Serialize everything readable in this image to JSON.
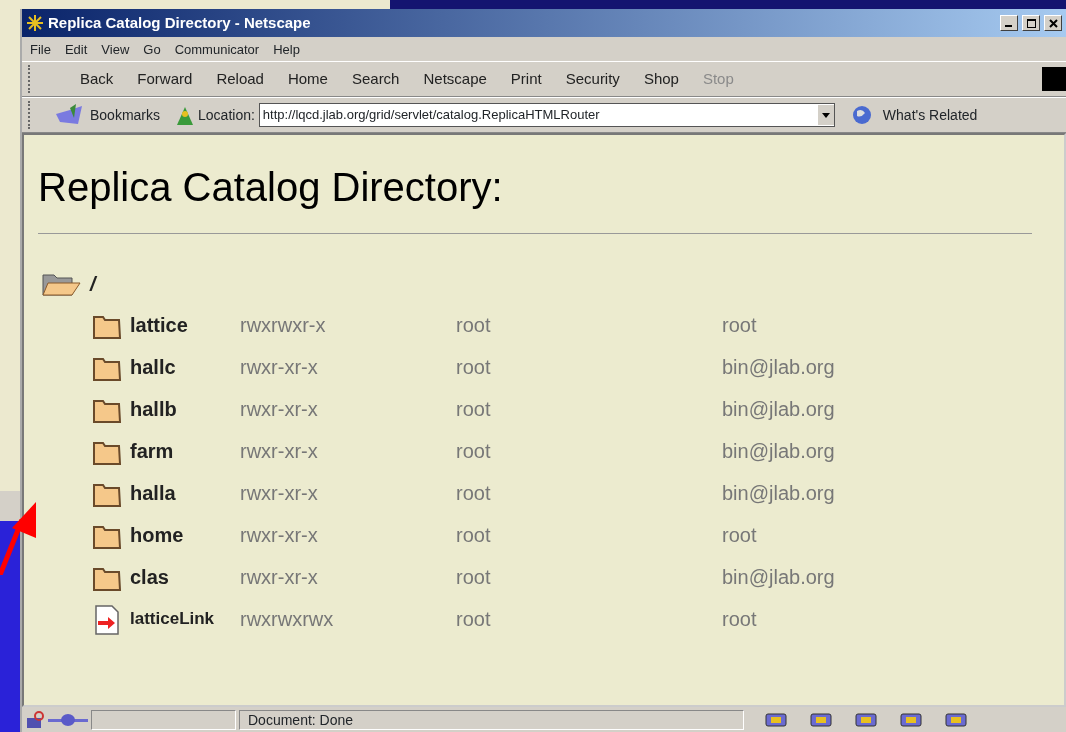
{
  "window": {
    "title": "Replica Catalog Directory - Netscape"
  },
  "menu": [
    "File",
    "Edit",
    "View",
    "Go",
    "Communicator",
    "Help"
  ],
  "toolbar": [
    {
      "label": "Back",
      "disabled": false
    },
    {
      "label": "Forward",
      "disabled": false
    },
    {
      "label": "Reload",
      "disabled": false
    },
    {
      "label": "Home",
      "disabled": false
    },
    {
      "label": "Search",
      "disabled": false
    },
    {
      "label": "Netscape",
      "disabled": false
    },
    {
      "label": "Print",
      "disabled": false
    },
    {
      "label": "Security",
      "disabled": false
    },
    {
      "label": "Shop",
      "disabled": false
    },
    {
      "label": "Stop",
      "disabled": true
    }
  ],
  "location_bar": {
    "bookmarks": "Bookmarks",
    "location_label": "Location:",
    "url": "http://lqcd.jlab.org/grid/servlet/catalog.ReplicaHTMLRouter",
    "related": "What's Related"
  },
  "page": {
    "heading": "Replica Catalog Directory:",
    "root": "/",
    "entries": [
      {
        "kind": "folder",
        "name": "lattice",
        "perms": "rwxrwxr-x",
        "owner": "root",
        "group": "root"
      },
      {
        "kind": "folder",
        "name": "hallc",
        "perms": "rwxr-xr-x",
        "owner": "root",
        "group": "bin@jlab.org"
      },
      {
        "kind": "folder",
        "name": "hallb",
        "perms": "rwxr-xr-x",
        "owner": "root",
        "group": "bin@jlab.org"
      },
      {
        "kind": "folder",
        "name": "farm",
        "perms": "rwxr-xr-x",
        "owner": "root",
        "group": "bin@jlab.org"
      },
      {
        "kind": "folder",
        "name": "halla",
        "perms": "rwxr-xr-x",
        "owner": "root",
        "group": "bin@jlab.org"
      },
      {
        "kind": "folder",
        "name": "home",
        "perms": "rwxr-xr-x",
        "owner": "root",
        "group": "root"
      },
      {
        "kind": "folder",
        "name": "clas",
        "perms": "rwxr-xr-x",
        "owner": "root",
        "group": "bin@jlab.org"
      },
      {
        "kind": "link",
        "name": "latticeLink",
        "perms": "rwxrwxrwx",
        "owner": "root",
        "group": "root"
      }
    ]
  },
  "status_bar": {
    "text": "Document: Done"
  }
}
